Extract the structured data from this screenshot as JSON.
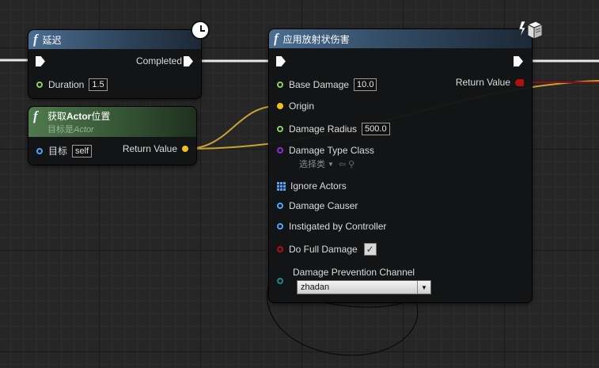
{
  "colors": {
    "exec": "#fafafa",
    "vector_pin": "#f0c020",
    "float_pin": "#8ad060",
    "class_pin": "#8a30d0",
    "object_pin": "#4da6ff",
    "bool_pin": "#b01010",
    "channel_pin": "#1a8a8a",
    "wire_yellow": "#c9a434",
    "wire_red": "#8c1010"
  },
  "delay_node": {
    "title": "延迟",
    "completed_label": "Completed",
    "duration_label": "Duration",
    "duration_value": "1.5"
  },
  "actor_node": {
    "title_prefix": "获取",
    "title_bold": "Actor",
    "title_suffix": "位置",
    "subtitle_prefix": "目标是",
    "subtitle_italic": "Actor",
    "target_label": "目标",
    "target_value": "self",
    "return_label": "Return Value"
  },
  "damage_node": {
    "title": "应用放射状伤害",
    "return_label": "Return Value",
    "base_damage_label": "Base Damage",
    "base_damage_value": "10.0",
    "origin_label": "Origin",
    "damage_radius_label": "Damage Radius",
    "damage_radius_value": "500.0",
    "damage_type_label": "Damage Type Class",
    "damage_type_select": "选择类",
    "ignore_actors_label": "Ignore Actors",
    "damage_causer_label": "Damage Causer",
    "instigated_label": "Instigated by Controller",
    "full_damage_label": "Do Full Damage",
    "full_damage_checked": "✓",
    "prevention_label": "Damage Prevention Channel",
    "prevention_value": "zhadan"
  }
}
